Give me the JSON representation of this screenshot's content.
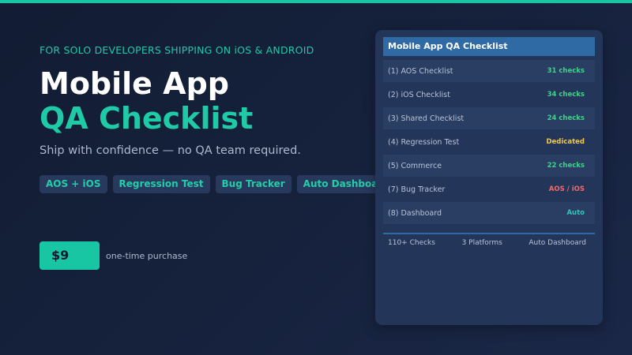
{
  "colors": {
    "accent": "#18c6a3",
    "background": "#16223d",
    "card": "#233559",
    "card_header": "#2f6aa5",
    "value_green": "#3fd28a",
    "value_yellow": "#f1c94a",
    "value_red": "#ef6b6b",
    "value_teal": "#2fc7b8"
  },
  "hero": {
    "eyebrow": "FOR SOLO DEVELOPERS SHIPPING ON iOS & ANDROID",
    "title_line1": "Mobile App",
    "title_line2": "QA Checklist",
    "tagline": "Ship with confidence — no QA team required."
  },
  "tags": [
    "AOS + iOS",
    "Regression Test",
    "Bug Tracker",
    "Auto Dashboard"
  ],
  "purchase": {
    "price": "$9",
    "note": "one-time purchase"
  },
  "card": {
    "title": "Mobile App QA Checklist",
    "rows": [
      {
        "label": "(1) AOS Checklist",
        "value": "31 checks",
        "color": "#3fd28a"
      },
      {
        "label": "(2) iOS Checklist",
        "value": "34 checks",
        "color": "#3fd28a"
      },
      {
        "label": "(3) Shared Checklist",
        "value": "24 checks",
        "color": "#3fd28a"
      },
      {
        "label": "(4) Regression Test",
        "value": "Dedicated",
        "color": "#f1c94a"
      },
      {
        "label": "(5) Commerce",
        "value": "22 checks",
        "color": "#3fd28a"
      },
      {
        "label": "(7) Bug Tracker",
        "value": "AOS / iOS",
        "color": "#ef6b6b"
      },
      {
        "label": "(8) Dashboard",
        "value": "Auto",
        "color": "#2fc7b8"
      }
    ],
    "footer": [
      "110+ Checks",
      "3 Platforms",
      "Auto Dashboard"
    ]
  }
}
